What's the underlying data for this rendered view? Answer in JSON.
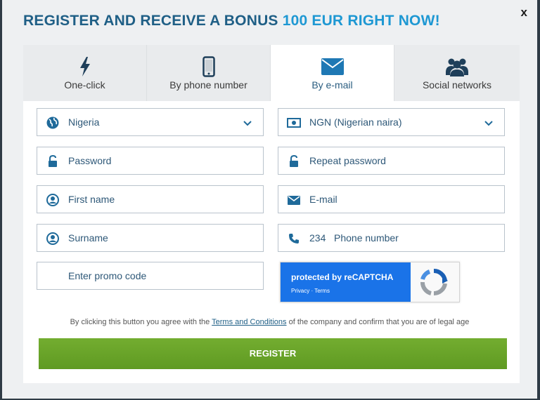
{
  "header": {
    "title_main": "REGISTER AND RECEIVE A BONUS ",
    "title_accent": "100 EUR RIGHT NOW!",
    "close": "x"
  },
  "tabs": [
    {
      "label": "One-click",
      "icon": "lightning-icon"
    },
    {
      "label": "By phone number",
      "icon": "phone-icon"
    },
    {
      "label": "By e-mail",
      "icon": "envelope-icon",
      "active": true
    },
    {
      "label": "Social networks",
      "icon": "people-icon"
    }
  ],
  "form": {
    "country": "Nigeria",
    "currency": "NGN (Nigerian naira)",
    "password_placeholder": "Password",
    "repeat_password_placeholder": "Repeat password",
    "first_name_placeholder": "First name",
    "email_placeholder": "E-mail",
    "surname_placeholder": "Surname",
    "phone_code": "234",
    "phone_placeholder": "Phone number",
    "promo_placeholder": "Enter promo code"
  },
  "recaptcha": {
    "label": "protected by reCAPTCHA",
    "links": "Privacy · Terms"
  },
  "agreement": {
    "before": "By clicking this button you agree with the ",
    "link": "Terms and Conditions",
    "after": " of the company and confirm that you are of legal age"
  },
  "register_label": "REGISTER",
  "colors": {
    "title": "#1f5f86",
    "accent": "#1e98d3",
    "icon_blue": "#1f6a9a",
    "register_green": "#6aa52a",
    "recaptcha_blue": "#1a73e8"
  }
}
